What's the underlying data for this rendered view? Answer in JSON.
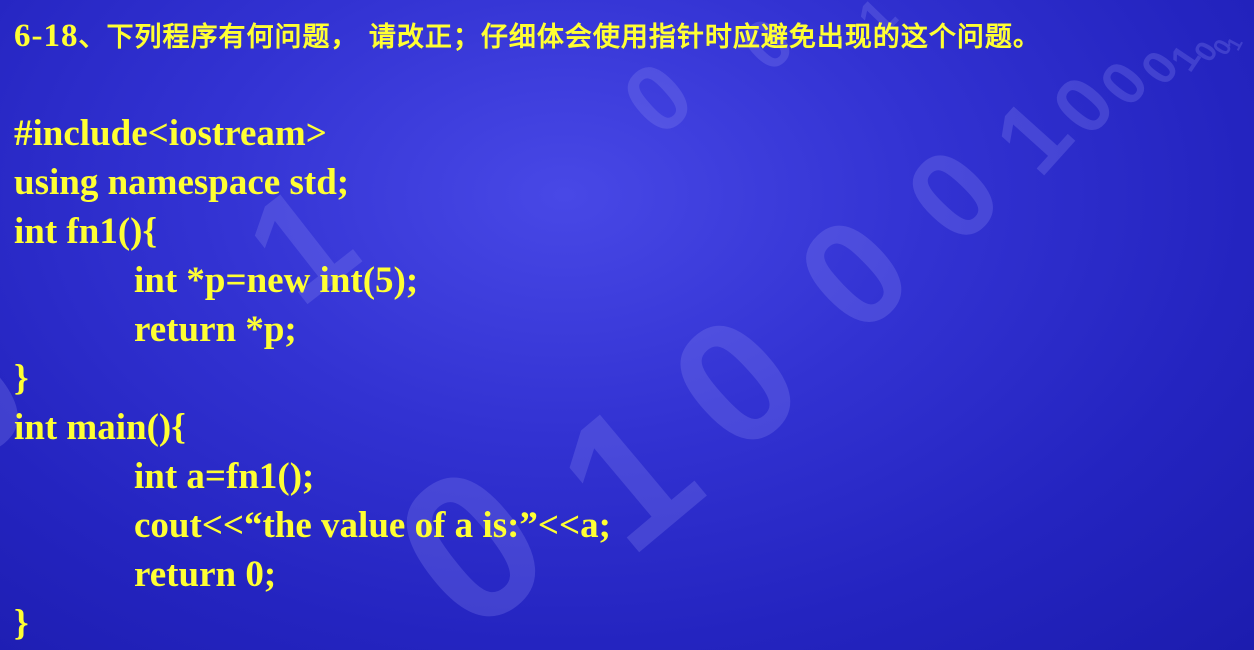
{
  "title": {
    "number": "6-18",
    "text": "、下列程序有何问题， 请改正；仔细体会使用指针时应避免出现的这个问题。"
  },
  "code": [
    "#include<iostream>",
    "using namespace std;",
    "int fn1(){",
    "int *p=new int(5);",
    "return *p;",
    "}",
    "int main(){",
    "int a=fn1();",
    "cout<<“the value of a is:”<<a;",
    "return 0;",
    "}"
  ],
  "watermark_text": "0100010001001",
  "colors": {
    "background": "#3232d2",
    "text": "#ffff33"
  }
}
